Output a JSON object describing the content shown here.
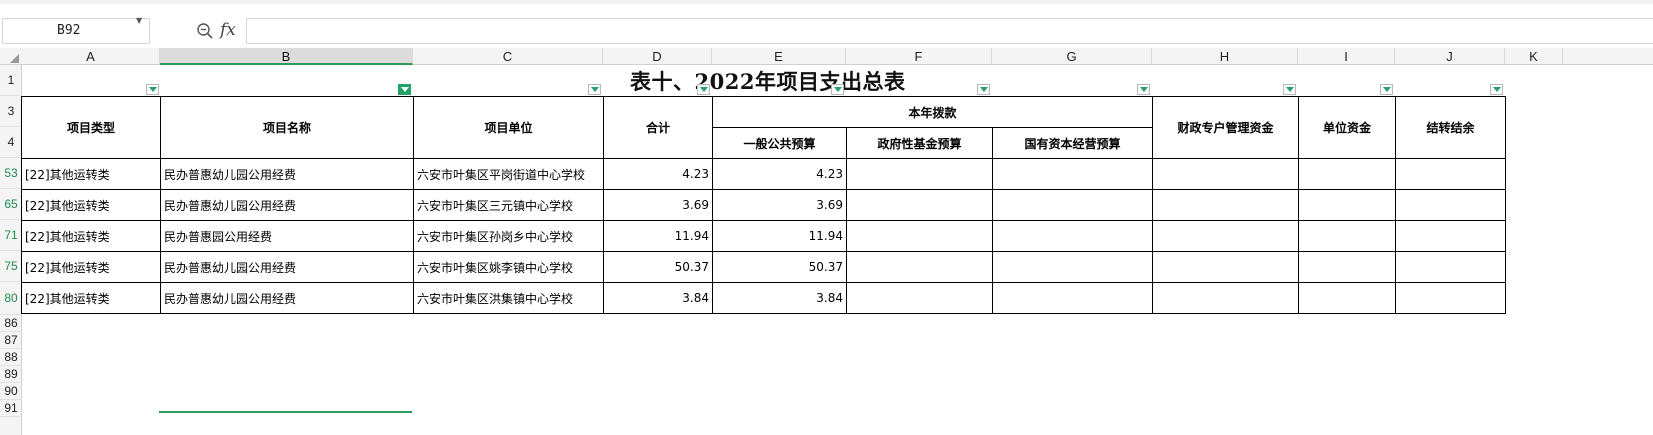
{
  "formula_bar": {
    "cell_ref": "B92",
    "fx": "fx",
    "value": ""
  },
  "columns": [
    "A",
    "B",
    "C",
    "D",
    "E",
    "F",
    "G",
    "H",
    "I",
    "J",
    "K"
  ],
  "active_column": "B",
  "rows": [
    "1",
    "3",
    "4",
    "53",
    "65",
    "71",
    "75",
    "80",
    "86",
    "87",
    "88",
    "89",
    "90",
    "91"
  ],
  "sheet": {
    "title": "表十、2022年项目支出总表",
    "headers": {
      "project_type": "项目类型",
      "project_name": "项目名称",
      "project_unit": "项目单位",
      "total": "合计",
      "annual_allocation": "本年拨款",
      "general_budget": "一般公共预算",
      "gov_fund_budget": "政府性基金预算",
      "state_capital_budget": "国有资本经营预算",
      "fiscal_special_funds": "财政专户管理资金",
      "unit_funds": "单位资金",
      "carryover": "结转结余"
    },
    "data_rows": [
      {
        "type": "[22]其他运转类",
        "name": "民办普惠幼儿园公用经费",
        "unit": "六安市叶集区平岗街道中心学校",
        "total": "4.23",
        "general": "4.23",
        "gov": "",
        "state": "",
        "fiscal": "",
        "unit_funds": "",
        "carry": ""
      },
      {
        "type": "[22]其他运转类",
        "name": "民办普惠幼儿园公用经费",
        "unit": "六安市叶集区三元镇中心学校",
        "total": "3.69",
        "general": "3.69",
        "gov": "",
        "state": "",
        "fiscal": "",
        "unit_funds": "",
        "carry": ""
      },
      {
        "type": "[22]其他运转类",
        "name": "民办普惠园公用经费",
        "unit": "六安市叶集区孙岗乡中心学校",
        "total": "11.94",
        "general": "11.94",
        "gov": "",
        "state": "",
        "fiscal": "",
        "unit_funds": "",
        "carry": ""
      },
      {
        "type": "[22]其他运转类",
        "name": "民办普惠幼儿园公用经费",
        "unit": "六安市叶集区姚李镇中心学校",
        "total": "50.37",
        "general": "50.37",
        "gov": "",
        "state": "",
        "fiscal": "",
        "unit_funds": "",
        "carry": ""
      },
      {
        "type": "[22]其他运转类",
        "name": "民办普惠幼儿园公用经费",
        "unit": "六安市叶集区洪集镇中心学校",
        "total": "3.84",
        "general": "3.84",
        "gov": "",
        "state": "",
        "fiscal": "",
        "unit_funds": "",
        "carry": ""
      }
    ]
  },
  "colors": {
    "accent_green": "#21a366",
    "grid": "#d8d8d8"
  },
  "icons": [
    "zoom-icon",
    "filter-arrow-icon",
    "filter-active-icon"
  ]
}
